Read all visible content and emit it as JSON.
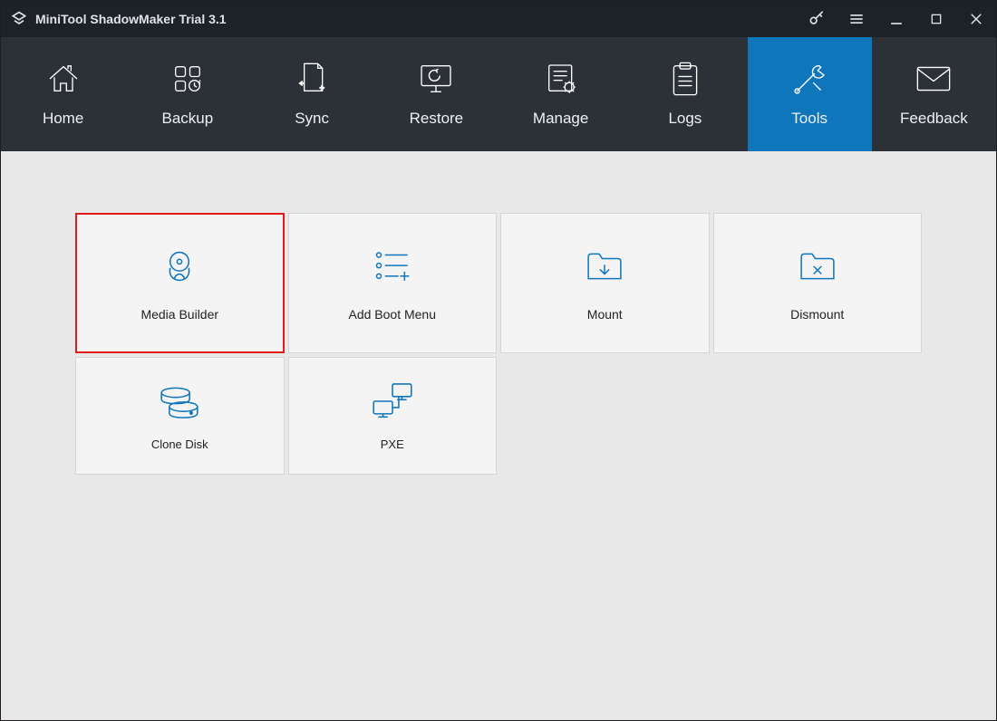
{
  "app": {
    "title": "MiniTool ShadowMaker Trial 3.1"
  },
  "nav": {
    "items": [
      {
        "label": "Home"
      },
      {
        "label": "Backup"
      },
      {
        "label": "Sync"
      },
      {
        "label": "Restore"
      },
      {
        "label": "Manage"
      },
      {
        "label": "Logs"
      },
      {
        "label": "Tools"
      },
      {
        "label": "Feedback"
      }
    ],
    "active_index": 6
  },
  "tools": {
    "row1": [
      {
        "label": "Media Builder",
        "highlight": true
      },
      {
        "label": "Add Boot Menu"
      },
      {
        "label": "Mount"
      },
      {
        "label": "Dismount"
      }
    ],
    "row2": [
      {
        "label": "Clone Disk"
      },
      {
        "label": "PXE"
      }
    ]
  },
  "colors": {
    "accent": "#1076bc",
    "highlight": "#e11b1b",
    "navbg": "#2b3137",
    "titlebg": "#1d2227"
  }
}
